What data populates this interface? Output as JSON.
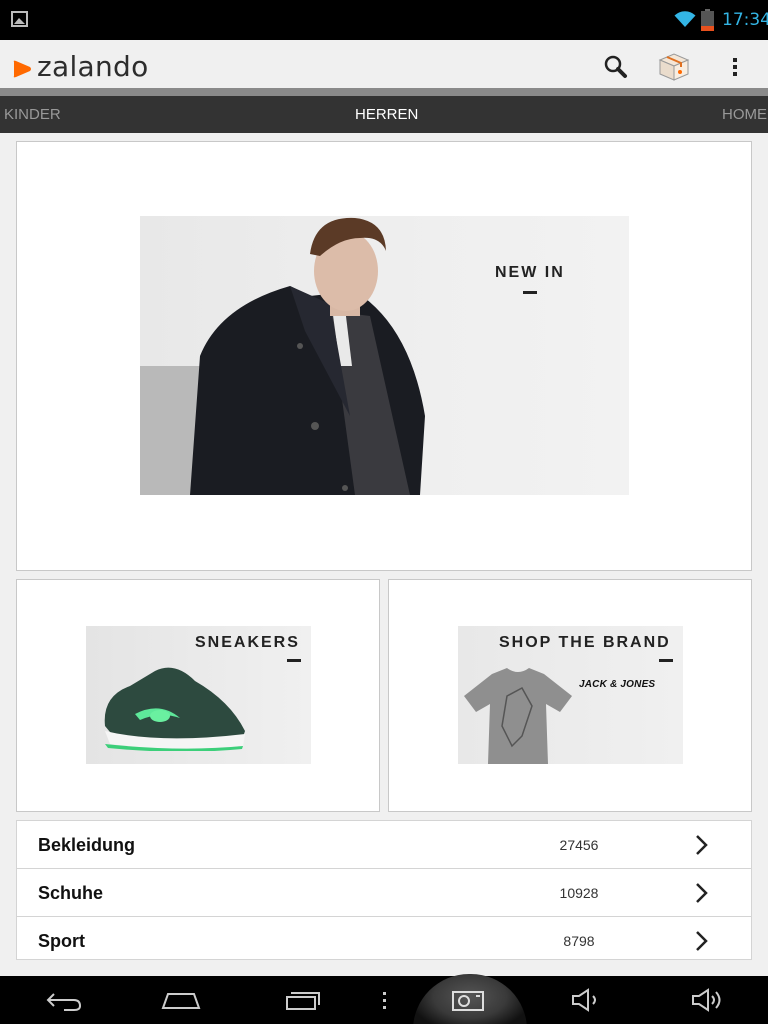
{
  "status_bar": {
    "time": "17:34"
  },
  "app_bar": {
    "brand": "zalando"
  },
  "tabs": [
    {
      "label": "KINDER"
    },
    {
      "label": "HERREN",
      "active": true
    },
    {
      "label": "HOME"
    }
  ],
  "hero": {
    "title": "NEW IN"
  },
  "promos": [
    {
      "title": "SNEAKERS"
    },
    {
      "title": "SHOP THE BRAND",
      "brand_logo": "JACK & JONES"
    }
  ],
  "categories": [
    {
      "label": "Bekleidung",
      "count": "27456"
    },
    {
      "label": "Schuhe",
      "count": "10928"
    },
    {
      "label": "Sport",
      "count": "8798"
    }
  ],
  "colors": {
    "brand_orange": "#ff6900",
    "clock_blue": "#33b5e5",
    "tabs_bg": "#333333"
  },
  "icons": [
    "image-notification-icon",
    "wifi-icon",
    "battery-icon",
    "search-icon",
    "cart-box-icon",
    "overflow-menu-icon",
    "chevron-right-icon",
    "back-icon",
    "home-icon",
    "recent-apps-icon",
    "menu-icon",
    "screenshot-camera-icon",
    "volume-down-icon",
    "volume-up-icon"
  ]
}
